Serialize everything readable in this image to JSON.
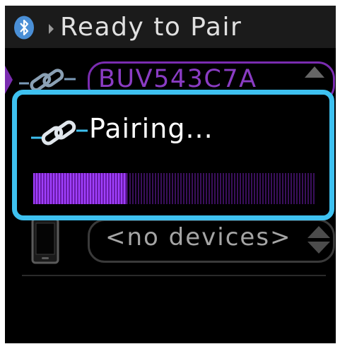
{
  "header": {
    "title": "Ready to Pair",
    "icon": "bluetooth-icon"
  },
  "rows": [
    {
      "icon": "link-icon",
      "value": "BUV543C7A",
      "selected": true
    },
    {
      "icon": "phone-icon",
      "value": "<no devices>",
      "selected": false
    }
  ],
  "dialog": {
    "icon": "link-icon",
    "title": "Pairing...",
    "progress": 0.33
  },
  "colors": {
    "accent_purple": "#7a2cb0",
    "dialog_border": "#3ec1f0",
    "header_bg": "#1b1b1b",
    "progress_fill": "#a040ff"
  }
}
